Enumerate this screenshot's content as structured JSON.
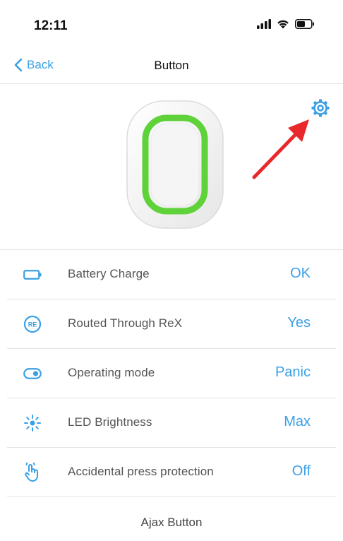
{
  "status_bar": {
    "time": "12:11",
    "icons": [
      "cellular-signal-icon",
      "wifi-icon",
      "battery-icon"
    ]
  },
  "nav": {
    "back_label": "Back",
    "title": "Button"
  },
  "colors": {
    "accent": "#3aa0e6",
    "device_ring": "#5fd23a",
    "arrow": "#e8282a"
  },
  "rows": [
    {
      "icon": "battery-outline-icon",
      "label": "Battery Charge",
      "value": "OK"
    },
    {
      "icon": "rex-icon",
      "label": "Routed Through ReX",
      "value": "Yes"
    },
    {
      "icon": "toggle-icon",
      "label": "Operating mode",
      "value": "Panic"
    },
    {
      "icon": "brightness-icon",
      "label": "LED Brightness",
      "value": "Max"
    },
    {
      "icon": "press-hand-icon",
      "label": "Accidental press protection",
      "value": "Off"
    }
  ],
  "footer": {
    "device_name": "Ajax Button"
  }
}
